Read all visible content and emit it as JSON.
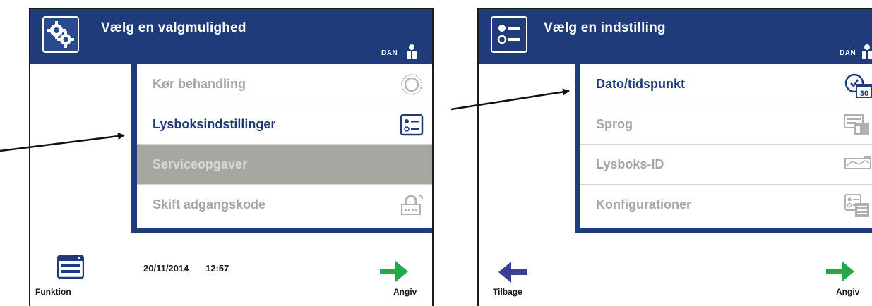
{
  "left_screen": {
    "title": "Vælg en valgmulighed",
    "language": "DAN",
    "menu": [
      {
        "label": "Kør behandling",
        "state": "disabled",
        "icon": "sun-icon"
      },
      {
        "label": "Lysboksindstillinger",
        "state": "active",
        "icon": "settings-list-icon"
      },
      {
        "label": "Serviceopgaver",
        "state": "highlighted",
        "icon": ""
      },
      {
        "label": "Skift adgangskode",
        "state": "disabled",
        "icon": "lock-icon"
      }
    ],
    "date": "20/11/2014",
    "time": "12:57",
    "footer_left": "Funktion",
    "footer_right": "Angiv"
  },
  "right_screen": {
    "title": "Vælg en indstilling",
    "language": "DAN",
    "menu": [
      {
        "label": "Dato/tidspunkt",
        "state": "active",
        "icon": "calendar-clock-icon",
        "icon_text": "30"
      },
      {
        "label": "Sprog",
        "state": "disabled",
        "icon": "language-icon"
      },
      {
        "label": "Lysboks-ID",
        "state": "disabled",
        "icon": "lightbox-id-icon"
      },
      {
        "label": "Konfigurationer",
        "state": "disabled",
        "icon": "configuration-icon"
      }
    ],
    "footer_left": "Tilbage",
    "footer_right": "Angiv"
  },
  "colors": {
    "header_blue": "#1f3b7a",
    "green_arrow": "#22a94a",
    "back_arrow": "#3d3f8f",
    "highlight_gray": "#a7a7a2"
  }
}
